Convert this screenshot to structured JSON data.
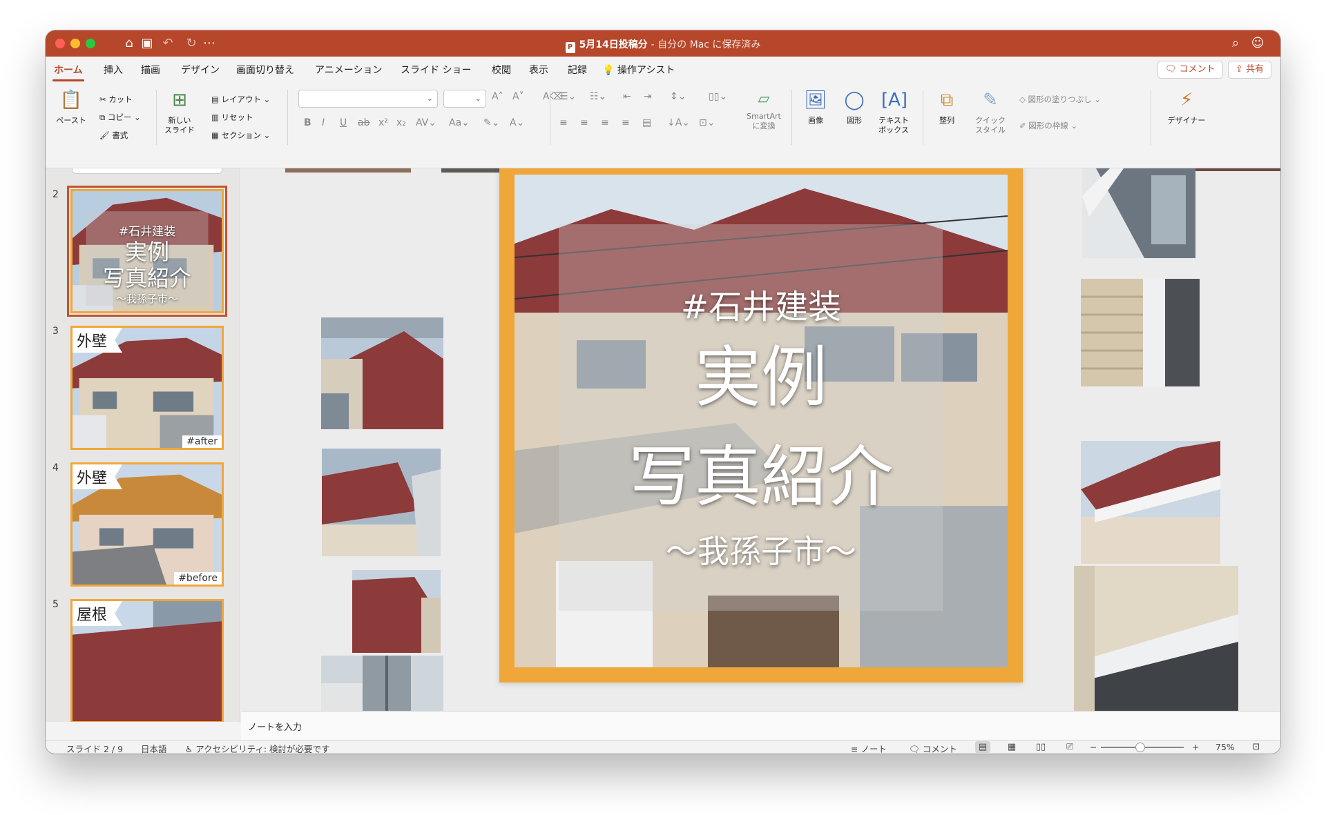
{
  "window": {
    "doc_title": "5月14日投稿分",
    "save_status": "- 自分の Mac に保存済み",
    "colors": {
      "accent": "#b7472a",
      "slide_frame": "#f0a73a",
      "roof": "#8c3a3a"
    }
  },
  "tabs": [
    "ホーム",
    "挿入",
    "描画",
    "デザイン",
    "画面切り替え",
    "アニメーション",
    "スライド ショー",
    "校閲",
    "表示",
    "記録",
    "操作アシスト"
  ],
  "tab_buttons": {
    "comment": "コメント",
    "share": "共有"
  },
  "ribbon": {
    "paste": "ペースト",
    "cut": "カット",
    "copy": "コピー",
    "format": "書式",
    "new_slide_1": "新しい",
    "new_slide_2": "スライド",
    "layout": "レイアウト",
    "reset": "リセット",
    "section": "セクション",
    "smartart_1": "SmartArt",
    "smartart_2": "に変換",
    "picture": "画像",
    "shapes": "図形",
    "textbox_1": "テキスト",
    "textbox_2": "ボックス",
    "arrange": "整列",
    "quick_style_1": "クイック",
    "quick_style_2": "スタイル",
    "shape_fill": "図形の塗りつぶし",
    "shape_outline": "図形の枠線",
    "designer": "デザイナー"
  },
  "thumbnails": [
    {
      "num": "2",
      "title_a": "#石井建装",
      "title_b": "実例",
      "title_c": "写真紹介",
      "title_d": "〜我孫子市〜"
    },
    {
      "num": "3",
      "label": "外壁",
      "tag": "#after"
    },
    {
      "num": "4",
      "label": "外壁",
      "tag": "#before"
    },
    {
      "num": "5",
      "label": "屋根"
    }
  ],
  "slide": {
    "line1": "#石井建装",
    "line2": "実例",
    "line3": "写真紹介",
    "line4": "〜我孫子市〜"
  },
  "notes_placeholder": "ノートを入力",
  "status": {
    "slide_pos": "スライド 2 / 9",
    "language": "日本語",
    "accessibility": "アクセシビリティ: 検討が必要です",
    "notes_btn": "ノート",
    "comments_btn": "コメント",
    "zoom": "75%"
  }
}
